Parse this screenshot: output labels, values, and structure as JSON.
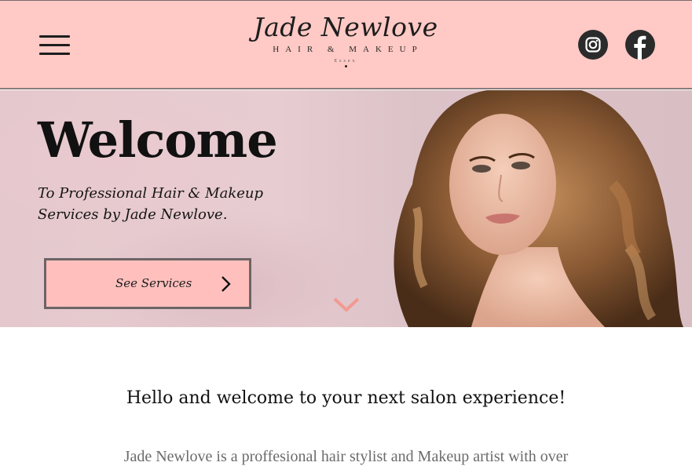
{
  "header": {
    "logo": {
      "name": "Jade Newlove",
      "tagline": "HAIR & MAKEUP",
      "location": "Essex"
    },
    "menu_icon": "hamburger-menu-icon",
    "social": [
      {
        "icon": "instagram-icon"
      },
      {
        "icon": "facebook-icon"
      }
    ],
    "colors": {
      "background": "#ffc9c5",
      "icon_bg": "#2b2b2b"
    }
  },
  "hero": {
    "title": "Welcome",
    "subtitle": "To Professional Hair & Makeup Services by Jade Newlove.",
    "cta_label": "See Services",
    "cta_icon": "chevron-right-icon",
    "scroll_icon": "chevron-down-icon",
    "colors": {
      "cta_bg": "#ffc0bd",
      "scroll_arrow": "#f29a92"
    }
  },
  "intro": {
    "heading": "Hello and welcome to your next salon experience!",
    "text": "Jade Newlove is a proffesional hair stylist and Makeup artist with over"
  }
}
